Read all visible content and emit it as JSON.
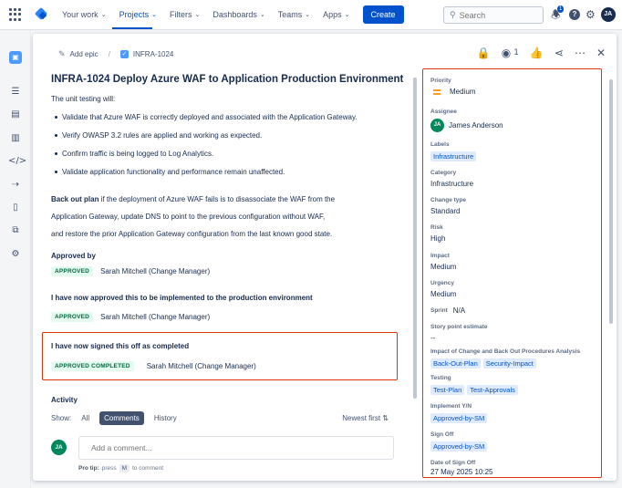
{
  "topnav": {
    "items": [
      {
        "label": "Your work",
        "active": false
      },
      {
        "label": "Projects",
        "active": true
      },
      {
        "label": "Filters",
        "active": false
      },
      {
        "label": "Dashboards",
        "active": false
      },
      {
        "label": "Teams",
        "active": false
      },
      {
        "label": "Apps",
        "active": false
      }
    ],
    "create_label": "Create",
    "search_placeholder": "Search",
    "notification_count": "1",
    "avatar_initials": "JA"
  },
  "sidebar": {
    "icons": [
      "project-icon",
      "backlog-icon",
      "board-list-icon",
      "board-icon",
      "code-icon",
      "releases-icon",
      "pages-icon",
      "shortcut-icon",
      "settings-icon"
    ]
  },
  "issue": {
    "breadcrumb_epic": "Add epic",
    "breadcrumb_key": "INFRA-1024",
    "watch_count": "1",
    "title": "INFRA-1024 Deploy Azure WAF to Application Production Environment",
    "description_intro": "The unit testing will:",
    "bullets": [
      "Validate that Azure WAF is correctly deployed and associated with the Application Gateway.",
      "Verify OWASP 3.2 rules are applied and working as expected.",
      "Confirm traffic is being logged to Log Analytics.",
      "Validate application functionality and performance remain unaffected."
    ],
    "backout_label": "Back out plan",
    "backout_text": " if the deployment of Azure WAF fails is to disassociate the WAF from the",
    "backout_line2": "Application Gateway, update DNS to point to the previous configuration without WAF,",
    "backout_line3": "and restore the prior Application Gateway configuration from the last known good state.",
    "approved_by_label": "Approved by",
    "approved_lozenge": "APPROVED",
    "approver": "Sarah Mitchell (Change Manager)",
    "statement_implement": "I have now approved this to be implemented to the production environment",
    "implement_lozenge": "APPROVED",
    "implement_approver": "Sarah Mitchell (Change Manager)",
    "statement_signed": "I have now signed this off as completed",
    "signed_lozenge": "APPROVED COMPLETED",
    "signed_approver": "Sarah Mitchell (Change Manager)"
  },
  "activity": {
    "label": "Activity",
    "show_label": "Show:",
    "filters": [
      "All",
      "Comments",
      "History"
    ],
    "selected_filter": "Comments",
    "sort_label": "Newest first",
    "comment_avatar": "JA",
    "comment_placeholder": "Add a comment...",
    "protip_label": "Pro tip:",
    "protip_press": "press",
    "protip_key": "M",
    "protip_suffix": "to comment"
  },
  "details": {
    "priority_label": "Priority",
    "priority_value": "Medium",
    "assignee_label": "Assignee",
    "assignee_initials": "JA",
    "assignee_name": "James Anderson",
    "labels_label": "Labels",
    "labels_value": "Infrastructure",
    "category_label": "Category",
    "category_value": "Infrastructure",
    "change_type_label": "Change type",
    "change_type_value": "Standard",
    "risk_label": "Risk",
    "risk_value": "High",
    "impact_label": "Impact",
    "impact_value": "Medium",
    "urgency_label": "Urgency",
    "urgency_value": "Medium",
    "sprint_label": "Sprint",
    "sprint_value": "N/A",
    "story_points_label": "Story point estimate",
    "story_points_value": "--",
    "impact_analysis_label": "Impact of Change and Back Out Procedures Analysis",
    "impact_analysis_tags": [
      "Back-Out-Plan",
      "Security-Impact"
    ],
    "testing_label": "Testing",
    "testing_tags": [
      "Test-Plan",
      "Test-Approvals"
    ],
    "implement_label": "Implement Y/N",
    "implement_tag": "Approved-by-SM",
    "signoff_label": "Sign Off",
    "signoff_tag": "Approved-by-SM",
    "date_signoff_label": "Date of Sign Off",
    "date_signoff_value": "27 May 2025 10:25"
  }
}
